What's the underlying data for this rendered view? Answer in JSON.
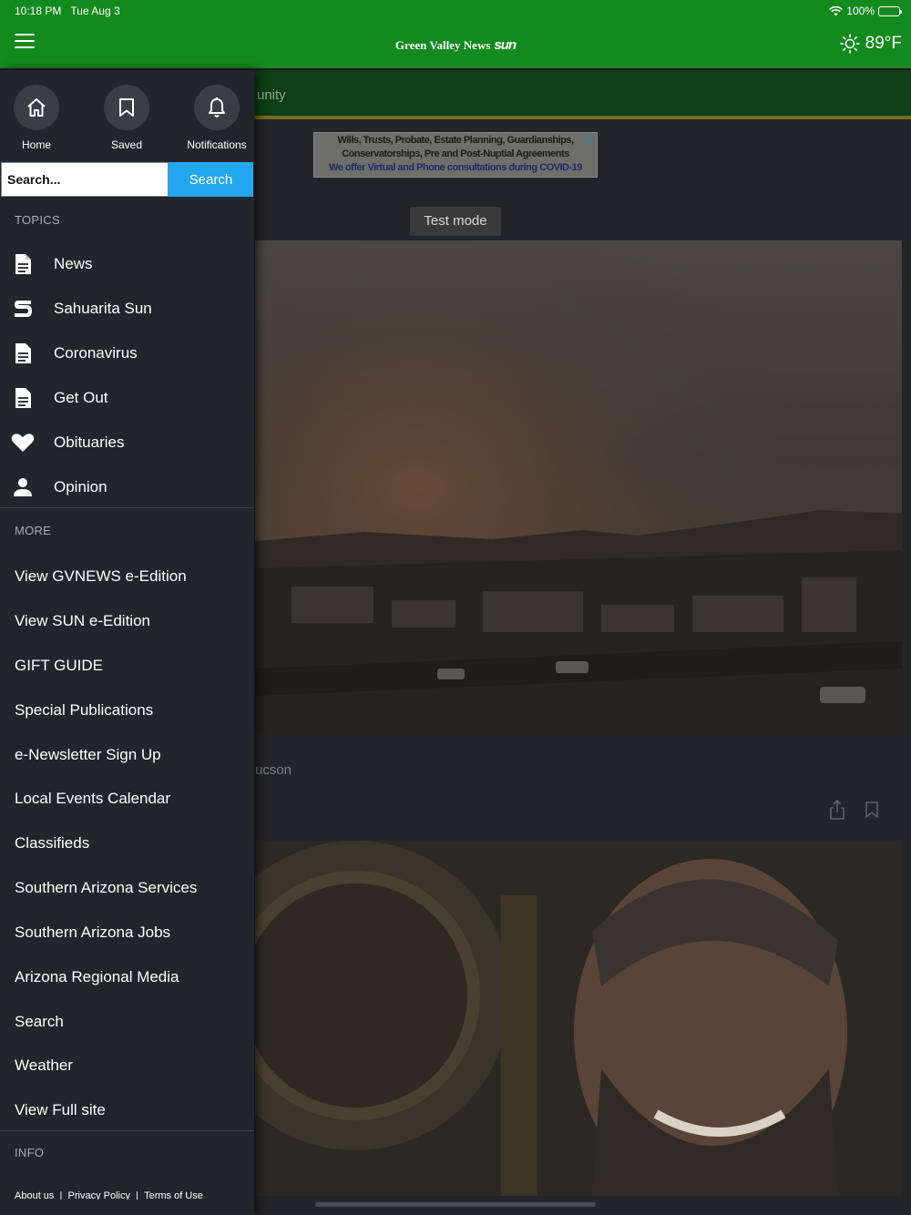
{
  "status_bar": {
    "time": "10:18 PM",
    "date": "Tue Aug 3",
    "battery": "100%"
  },
  "header": {
    "brand_name": "Green Valley News",
    "brand_sun": "sun",
    "temperature": "89°F"
  },
  "background": {
    "section_label": "unity",
    "ad_line1": "Wills, Trusts, Probate, Estate Planning, Guardianships,",
    "ad_line2": "Conservatorships, Pre and Post-Nuptial Agreements",
    "ad_line3": "We offer Virtual and Phone consultations during COVID-19",
    "ad_close": "✕",
    "test_mode": "Test mode",
    "caption": "ucson"
  },
  "drawer": {
    "quick_actions": [
      {
        "label": "Home",
        "icon": "home-icon"
      },
      {
        "label": "Saved",
        "icon": "bookmark-icon"
      },
      {
        "label": "Notifications",
        "icon": "bell-icon"
      }
    ],
    "search_placeholder": "Search...",
    "search_button": "Search",
    "topics_heading": "TOPICS",
    "topics": [
      {
        "label": "News",
        "icon": "document-icon"
      },
      {
        "label": "Sahuarita Sun",
        "icon": "sun-logo-icon"
      },
      {
        "label": "Coronavirus",
        "icon": "document-icon"
      },
      {
        "label": "Get Out",
        "icon": "document-icon"
      },
      {
        "label": "Obituaries",
        "icon": "heart-icon"
      },
      {
        "label": "Opinion",
        "icon": "person-icon"
      }
    ],
    "more_heading": "MORE",
    "more": [
      "View GVNEWS e-Edition",
      "View SUN e-Edition",
      "GIFT GUIDE",
      "Special Publications",
      "e-Newsletter Sign Up",
      "Local Events Calendar",
      "Classifieds",
      "Southern Arizona Services",
      "Southern Arizona Jobs",
      "Arizona Regional Media",
      "Search",
      "Weather",
      "View Full site"
    ],
    "info_heading": "INFO",
    "info_links": [
      "About us",
      "Privacy Policy",
      "Terms of Use"
    ]
  }
}
